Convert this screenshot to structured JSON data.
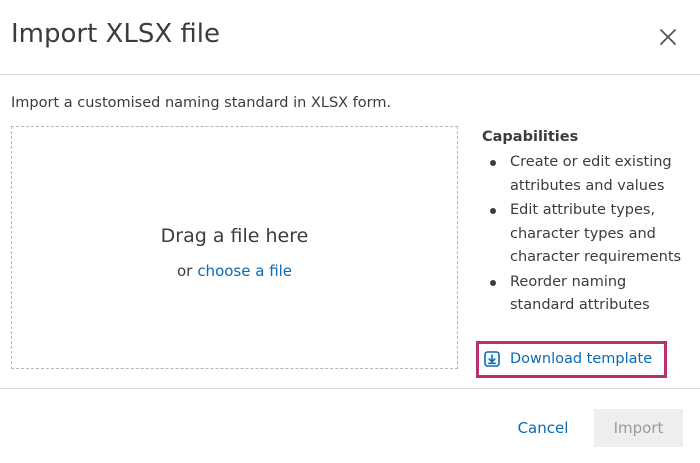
{
  "dialog": {
    "title": "Import XLSX file",
    "close_icon": "close-icon"
  },
  "intro": "Import a customised naming standard in XLSX form.",
  "dropzone": {
    "primary_text": "Drag a file here",
    "or_text": "or",
    "choose_link": "choose a file"
  },
  "capabilities": {
    "title": "Capabilities",
    "items": [
      "Create or edit existing attributes and values",
      "Edit attribute types, character types and character requirements",
      "Reorder naming standard attributes"
    ],
    "download_icon": "download-icon",
    "download_label": "Download template",
    "highlight_color": "#b8306e"
  },
  "footer": {
    "cancel_label": "Cancel",
    "import_label": "Import"
  },
  "colors": {
    "link": "#0a6ab5",
    "text": "#3c3c3c",
    "divider": "#d9d9d9",
    "disabled_bg": "#eeeeee",
    "disabled_text": "#9a9a9a"
  }
}
